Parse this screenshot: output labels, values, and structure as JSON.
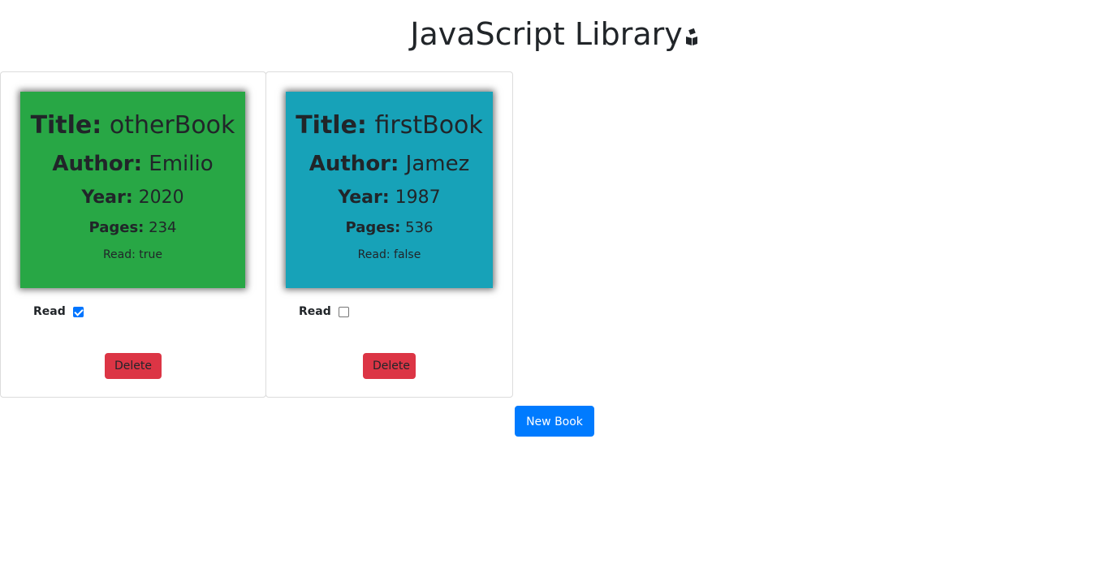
{
  "header": {
    "title": "JavaScript Library",
    "icon": "book-stack-icon"
  },
  "books": [
    {
      "title_label": "Title:",
      "title": "otherBook",
      "author_label": "Author:",
      "author": "Emilio",
      "year_label": "Year:",
      "year": "2020",
      "pages_label": "Pages:",
      "pages": "234",
      "read_status": "Read: true",
      "color": "#28a745",
      "checkbox_label": "Read",
      "read": true,
      "delete_label": "Delete"
    },
    {
      "title_label": "Title:",
      "title": "firstBook",
      "author_label": "Author:",
      "author": "Jamez",
      "year_label": "Year:",
      "year": "1987",
      "pages_label": "Pages:",
      "pages": "536",
      "read_status": "Read: false",
      "color": "#17a2b8",
      "checkbox_label": "Read",
      "read": false,
      "delete_label": "Delete"
    }
  ],
  "new_book_label": "New Book",
  "colors": {
    "delete": "#dc3545",
    "primary": "#007bff"
  }
}
